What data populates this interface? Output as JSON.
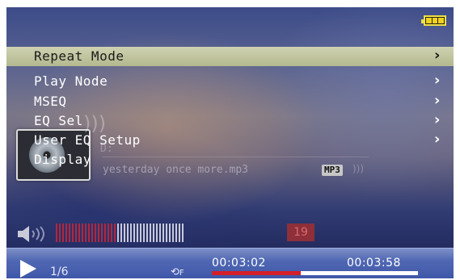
{
  "menu": {
    "items": [
      {
        "label": "Repeat Mode",
        "selected": true
      },
      {
        "label": "Play Node",
        "selected": false
      },
      {
        "label": "MSEQ",
        "selected": false
      },
      {
        "label": "EQ Sel",
        "selected": false
      },
      {
        "label": "User EQ Setup",
        "selected": false
      },
      {
        "label": "Display",
        "selected": false
      }
    ],
    "chevron": "›"
  },
  "background_player": {
    "drive_letter": "D:",
    "track_name": "yesterday once more.mp3",
    "format": "MP3"
  },
  "volume": {
    "level": 19,
    "max": 40
  },
  "player": {
    "track_index": "1/6",
    "repeat_indicator": "F",
    "elapsed": "00:03:02",
    "total": "00:03:58",
    "progress": 0.43
  },
  "colors": {
    "selection": "#c3c6a0",
    "accent_red": "#d41e28",
    "volume_filled": "#b0283e",
    "volume_empty": "#c8cad8"
  }
}
